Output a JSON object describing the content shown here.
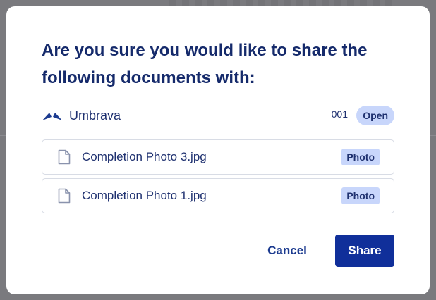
{
  "dialog": {
    "title": "Are you sure you would like to share the following documents with:",
    "organization": {
      "name": "Umbrava",
      "number": "001",
      "status": "Open",
      "logo_icon": "umbrava-logo-icon"
    },
    "documents": [
      {
        "name": "Completion Photo 3.jpg",
        "type": "Photo",
        "icon": "file-icon"
      },
      {
        "name": "Completion Photo 1.jpg",
        "type": "Photo",
        "icon": "file-icon"
      }
    ],
    "actions": {
      "cancel_label": "Cancel",
      "share_label": "Share"
    }
  },
  "colors": {
    "primary": "#102f9a",
    "text": "#152a6b",
    "badge_bg": "#c8d6fb",
    "overlay": "#7a7a7e"
  }
}
